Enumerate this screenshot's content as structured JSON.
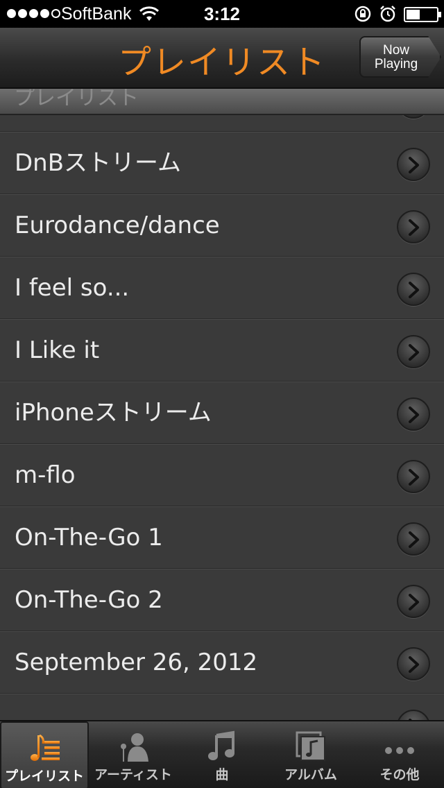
{
  "status_bar": {
    "carrier": "SoftBank",
    "time": "3:12",
    "signal_bars": 4,
    "battery_level_pct": 45
  },
  "nav": {
    "title": "プレイリスト",
    "now_playing_line1": "Now",
    "now_playing_line2": "Playing"
  },
  "list": {
    "section_header": "プレイリスト",
    "items": [
      {
        "label": "DnBストリーム"
      },
      {
        "label": "Eurodance/dance"
      },
      {
        "label": "I feel so..."
      },
      {
        "label": "I Like it"
      },
      {
        "label": "iPhoneストリーム"
      },
      {
        "label": "m-flo"
      },
      {
        "label": "On-The-Go 1"
      },
      {
        "label": "On-The-Go 2"
      },
      {
        "label": "September 26, 2012"
      }
    ]
  },
  "tabs": [
    {
      "label": "プレイリスト",
      "icon": "playlist-icon",
      "selected": true
    },
    {
      "label": "アーティスト",
      "icon": "artist-icon",
      "selected": false
    },
    {
      "label": "曲",
      "icon": "music-note-icon",
      "selected": false
    },
    {
      "label": "アルバム",
      "icon": "album-icon",
      "selected": false
    },
    {
      "label": "その他",
      "icon": "more-icon",
      "selected": false
    }
  ],
  "colors": {
    "accent": "#f08a24",
    "row_background": "#3a3a3a",
    "row_text": "#ececec"
  }
}
